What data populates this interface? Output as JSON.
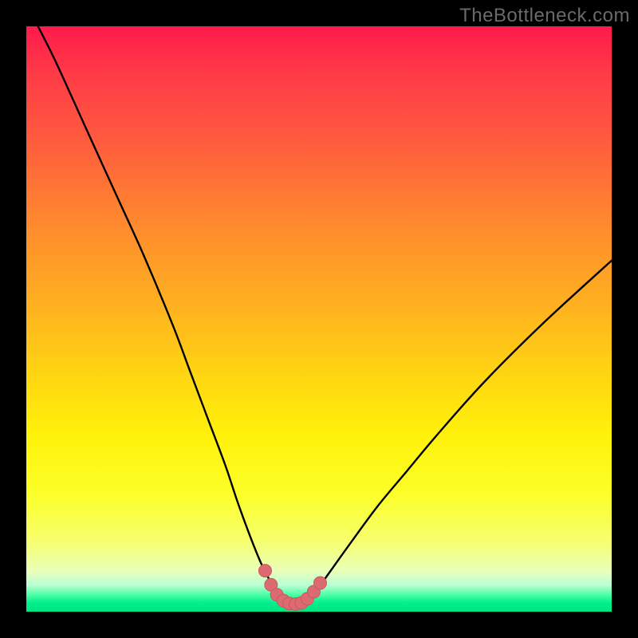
{
  "watermark": "TheBottleneck.com",
  "colors": {
    "background": "#000000",
    "curve_stroke": "#000000",
    "marker_fill": "#dc6b71",
    "marker_stroke": "#c9575e"
  },
  "chart_data": {
    "type": "line",
    "title": "",
    "xlabel": "",
    "ylabel": "",
    "xlim": [
      0,
      100
    ],
    "ylim": [
      0,
      100
    ],
    "series": [
      {
        "name": "bottleneck-curve",
        "x": [
          2,
          5,
          10,
          15,
          20,
          25,
          28,
          31,
          34,
          36,
          38,
          40,
          41.5,
          43,
          44,
          45,
          46,
          47,
          48,
          50,
          52,
          55,
          60,
          65,
          70,
          78,
          88,
          100
        ],
        "y": [
          100,
          94,
          83,
          72,
          61,
          49,
          41,
          33,
          25,
          19,
          13.5,
          8.5,
          5.5,
          3.2,
          1.8,
          1.2,
          1.2,
          1.6,
          2.4,
          4.3,
          7.0,
          11.2,
          18,
          24,
          30,
          39,
          49,
          60
        ]
      }
    ],
    "markers": {
      "name": "trough-markers",
      "x": [
        40.8,
        41.8,
        42.8,
        43.9,
        44.9,
        46.0,
        47.0,
        48.0,
        49.1,
        50.2
      ],
      "y": [
        7.0,
        4.6,
        2.9,
        1.9,
        1.4,
        1.3,
        1.5,
        2.2,
        3.4,
        4.9
      ]
    }
  }
}
